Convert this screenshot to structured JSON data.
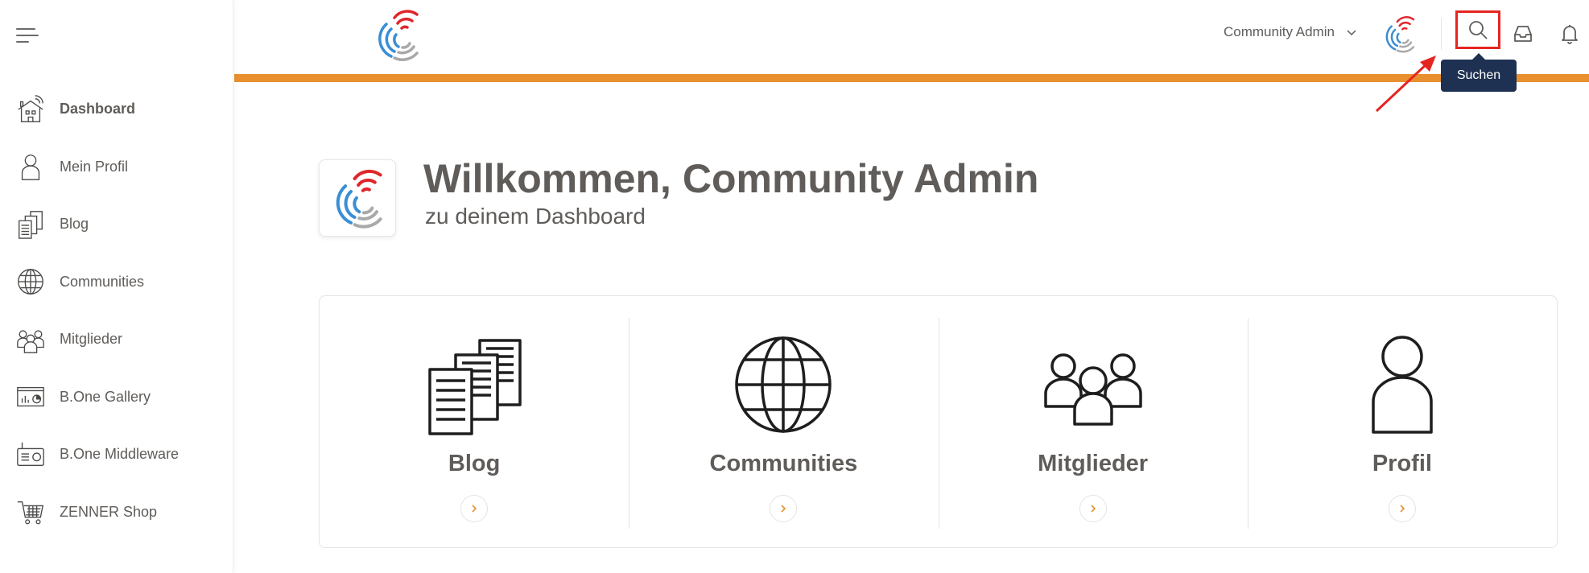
{
  "colors": {
    "accent": "#e8902f",
    "tooltip_bg": "#1f3152",
    "highlight": "#e52521",
    "text": "#5f5c59",
    "logo_red": "#e0262b",
    "logo_blue": "#3a8ed4",
    "logo_gray": "#a9a9a9"
  },
  "sidebar": {
    "menu_icon": "hamburger-icon",
    "items": [
      {
        "label": "Dashboard",
        "icon": "house-wifi-icon",
        "active": true
      },
      {
        "label": "Mein Profil",
        "icon": "person-icon",
        "active": false
      },
      {
        "label": "Blog",
        "icon": "documents-icon",
        "active": false
      },
      {
        "label": "Communities",
        "icon": "globe-icon",
        "active": false
      },
      {
        "label": "Mitglieder",
        "icon": "group-icon",
        "active": false
      },
      {
        "label": "B.One Gallery",
        "icon": "chart-window-icon",
        "active": false
      },
      {
        "label": "B.One Middleware",
        "icon": "radio-device-icon",
        "active": false
      },
      {
        "label": "ZENNER Shop",
        "icon": "shopping-cart-icon",
        "active": false
      }
    ]
  },
  "header": {
    "user_name": "Community Admin",
    "search_tooltip": "Suchen",
    "icons": [
      "search-icon",
      "inbox-icon",
      "bell-icon"
    ]
  },
  "welcome": {
    "greeting": "Willkommen,",
    "name": " Community Admin",
    "subtitle": "zu deinem Dashboard"
  },
  "cards": [
    {
      "title": "Blog",
      "icon": "documents-icon"
    },
    {
      "title": "Communities",
      "icon": "globe-icon"
    },
    {
      "title": "Mitglieder",
      "icon": "group-icon"
    },
    {
      "title": "Profil",
      "icon": "person-icon"
    }
  ]
}
